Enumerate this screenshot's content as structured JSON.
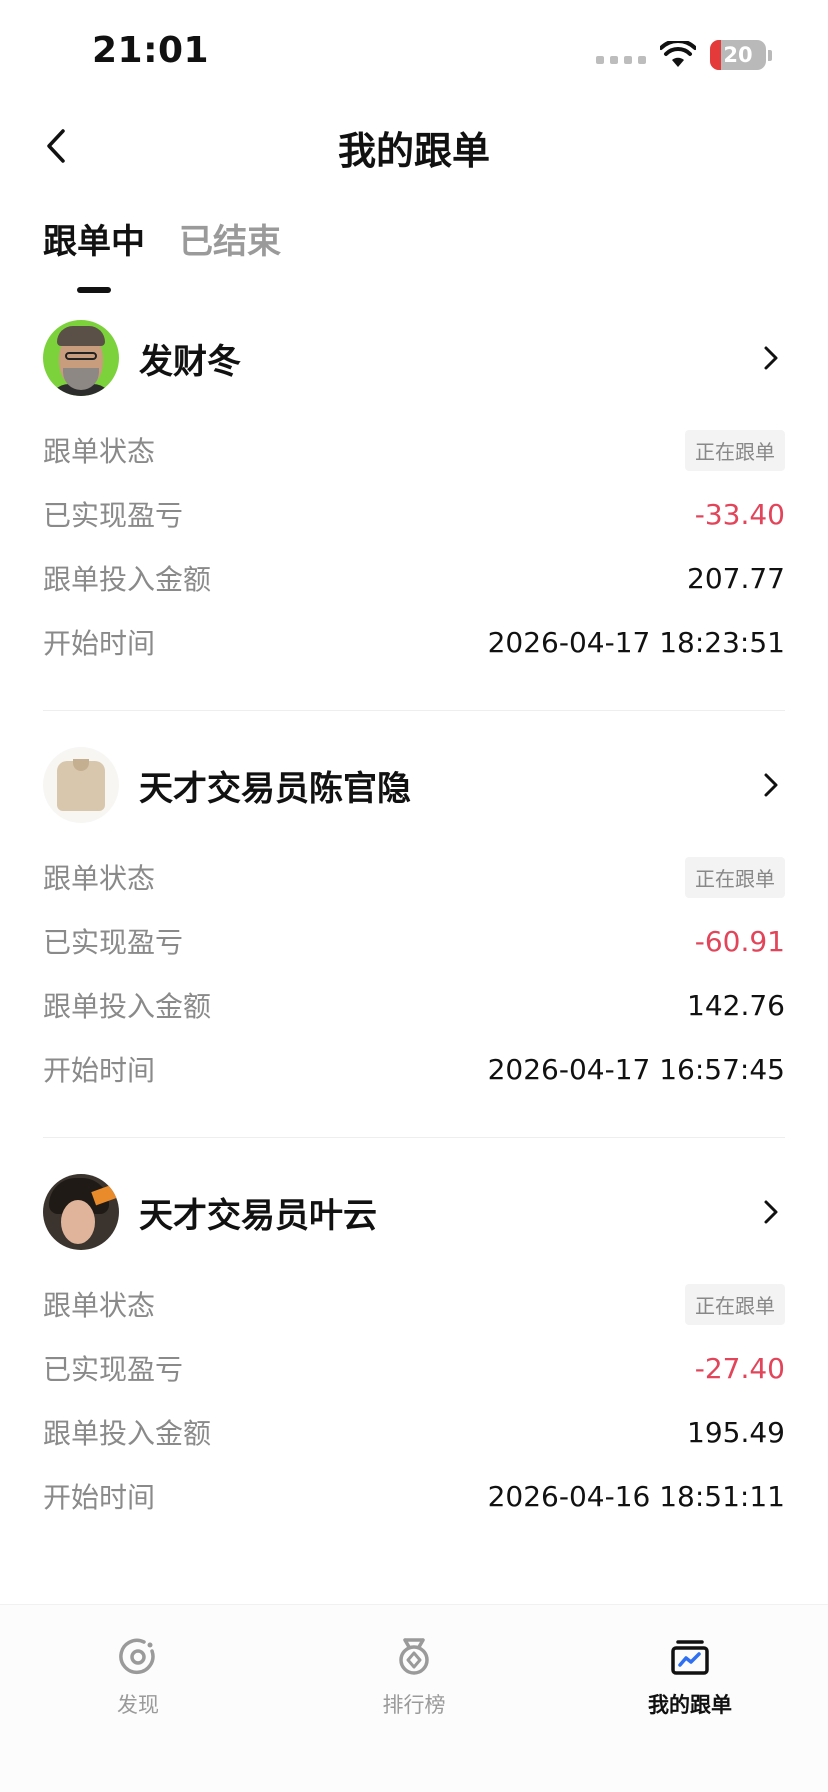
{
  "status_bar": {
    "time": "21:01",
    "battery": "20"
  },
  "header": {
    "title": "我的跟单"
  },
  "tabs": [
    {
      "label": "跟单中",
      "active": true
    },
    {
      "label": "已结束",
      "active": false
    }
  ],
  "labels": {
    "status": "跟单状态",
    "pnl": "已实现盈亏",
    "amount": "跟单投入金额",
    "start_time": "开始时间"
  },
  "traders": [
    {
      "name": "发财冬",
      "status": "正在跟单",
      "pnl": "-33.40",
      "amount": "207.77",
      "start_time": "2026-04-17 18:23:51"
    },
    {
      "name": "天才交易员陈官隐",
      "status": "正在跟单",
      "pnl": "-60.91",
      "amount": "142.76",
      "start_time": "2026-04-17 16:57:45"
    },
    {
      "name": "天才交易员叶云",
      "status": "正在跟单",
      "pnl": "-27.40",
      "amount": "195.49",
      "start_time": "2026-04-16 18:51:11"
    }
  ],
  "bottom_nav": [
    {
      "label": "发现",
      "icon": "discover-icon",
      "active": false
    },
    {
      "label": "排行榜",
      "icon": "medal-icon",
      "active": false
    },
    {
      "label": "我的跟单",
      "icon": "my-copy-trade-icon",
      "active": true
    }
  ],
  "colors": {
    "negative": "#e2455a",
    "accent": "#111111"
  }
}
